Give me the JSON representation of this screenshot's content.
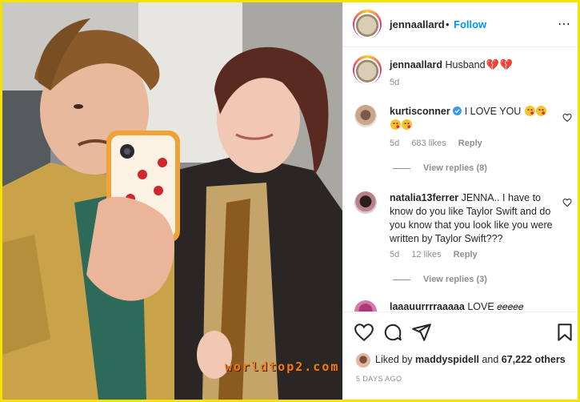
{
  "post": {
    "username": "jennaallard",
    "follow_label": "Follow",
    "separator": "•",
    "caption_user": "jennaallard",
    "caption_text": "Husband",
    "caption_age": "5d",
    "caption_emoji": "💔",
    "watermark": "worldtop2.com"
  },
  "comments": [
    {
      "user": "kurtisconner",
      "verified": true,
      "text": "I LOVE YOU",
      "age": "5d",
      "likes": "683 likes",
      "reply_label": "Reply",
      "view_replies": "View replies (8)"
    },
    {
      "user": "natalia13ferrer",
      "verified": false,
      "text": "JENNA.. I have to know do you like Taylor Swift and do you know that you look like you were written by Taylor Swift???",
      "age": "5d",
      "likes": "12 likes",
      "reply_label": "Reply",
      "view_replies": "View replies (3)"
    },
    {
      "user": "laaauurrrraaaaa",
      "text": "LOVE 𝑒𝑒𝑒𝑒𝑒"
    }
  ],
  "footer": {
    "liked_prefix": "Liked by",
    "liked_user": "maddyspidell",
    "liked_and": "and",
    "liked_others": "67,222 others",
    "time_ago": "5 DAYS AGO"
  },
  "icons": {
    "like": "heart-icon",
    "comment": "comment-icon",
    "share": "share-icon",
    "save": "bookmark-icon",
    "more": "more-icon"
  },
  "colors": {
    "frame": "#f5e200",
    "follow": "#0095f6",
    "watermark": "#f07a1a"
  }
}
